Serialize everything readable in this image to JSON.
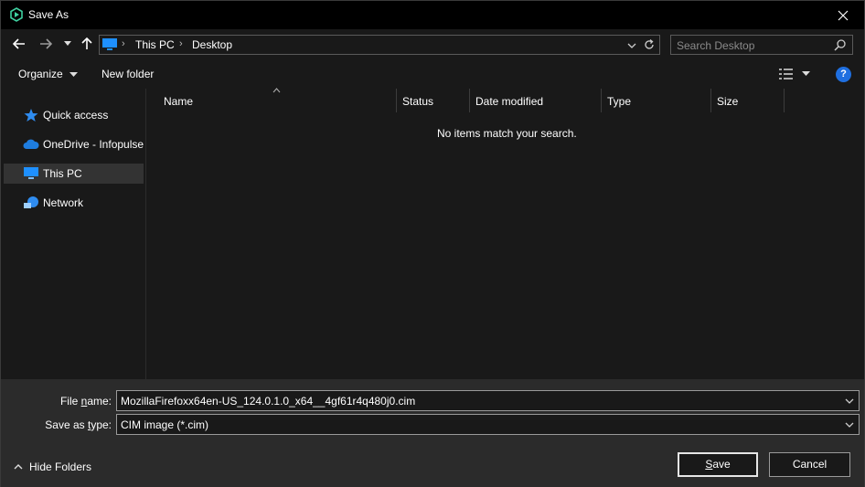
{
  "window": {
    "title": "Save As"
  },
  "nav": {
    "breadcrumb": [
      "This PC",
      "Desktop"
    ],
    "search_placeholder": "Search Desktop"
  },
  "commands": {
    "organize": "Organize",
    "new_folder": "New folder",
    "help": "?"
  },
  "sidebar": {
    "items": [
      {
        "label": "Quick access",
        "icon": "star-icon"
      },
      {
        "label": "OneDrive - Infopulse",
        "icon": "cloud-icon"
      },
      {
        "label": "This PC",
        "icon": "computer-icon",
        "selected": true
      },
      {
        "label": "Network",
        "icon": "network-icon"
      }
    ]
  },
  "filelist": {
    "columns": [
      "Name",
      "Status",
      "Date modified",
      "Type",
      "Size"
    ],
    "empty_message": "No items match your search."
  },
  "form": {
    "file_name_label_pre": "File ",
    "file_name_label_key": "n",
    "file_name_label_post": "ame:",
    "file_name_value": "MozillaFirefoxx64en-US_124.0.1.0_x64__4gf61r4q480j0.cim",
    "save_type_label_pre": "Save as ",
    "save_type_label_key": "t",
    "save_type_label_post": "ype:",
    "save_type_value": "CIM image (*.cim)"
  },
  "footer": {
    "hide_folders": "Hide Folders",
    "save_key": "S",
    "save_rest": "ave",
    "cancel": "Cancel"
  },
  "colors": {
    "accent": "#1f6fe0",
    "background": "#191919",
    "panel": "#2b2b2b"
  }
}
